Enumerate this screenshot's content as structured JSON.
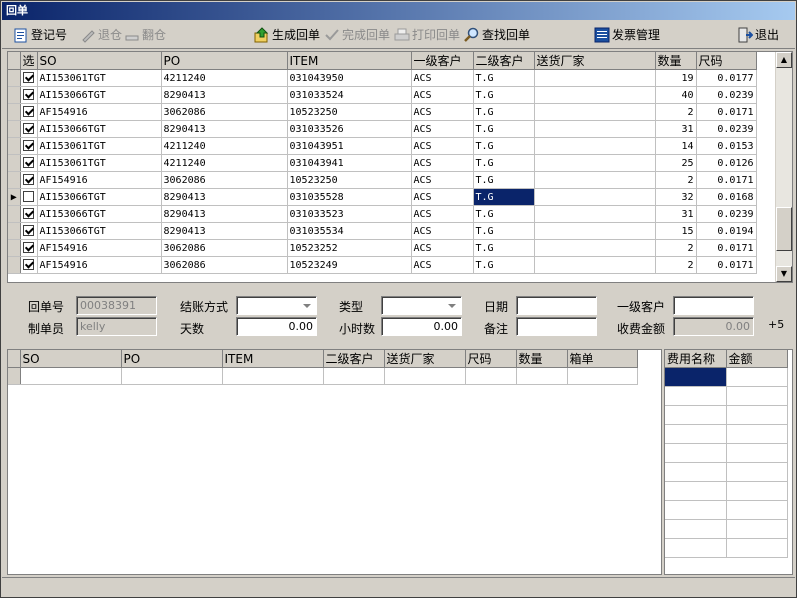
{
  "title": "回单",
  "toolbar": {
    "register": "登记号",
    "return_warehouse": "退仓",
    "flip_warehouse": "翻仓",
    "generate_receipt": "生成回单",
    "complete_receipt": "完成回单",
    "print_receipt": "打印回单",
    "find_receipt": "查找回单",
    "invoice_mgmt": "发票管理",
    "exit": "退出"
  },
  "grid": {
    "headers": [
      "选",
      "SO",
      "PO",
      "ITEM",
      "一级客户",
      "二级客户",
      "送货厂家",
      "数量",
      "尺码"
    ],
    "rows": [
      {
        "checked": true,
        "so": "AI153061TGT",
        "po": "4211240",
        "item": "031043950",
        "c1": "ACS",
        "c2": "T.G",
        "vendor": "",
        "qty": "19",
        "size": "0.0177"
      },
      {
        "checked": true,
        "so": "AI153066TGT",
        "po": "8290413",
        "item": "031033524",
        "c1": "ACS",
        "c2": "T.G",
        "vendor": "",
        "qty": "40",
        "size": "0.0239"
      },
      {
        "checked": true,
        "so": "AF154916",
        "po": "3062086",
        "item": "10523250",
        "c1": "ACS",
        "c2": "T.G",
        "vendor": "",
        "qty": "2",
        "size": "0.0171"
      },
      {
        "checked": true,
        "so": "AI153066TGT",
        "po": "8290413",
        "item": "031033526",
        "c1": "ACS",
        "c2": "T.G",
        "vendor": "",
        "qty": "31",
        "size": "0.0239"
      },
      {
        "checked": true,
        "so": "AI153061TGT",
        "po": "4211240",
        "item": "031043951",
        "c1": "ACS",
        "c2": "T.G",
        "vendor": "",
        "qty": "14",
        "size": "0.0153"
      },
      {
        "checked": true,
        "so": "AI153061TGT",
        "po": "4211240",
        "item": "031043941",
        "c1": "ACS",
        "c2": "T.G",
        "vendor": "",
        "qty": "25",
        "size": "0.0126"
      },
      {
        "checked": true,
        "so": "AF154916",
        "po": "3062086",
        "item": "10523250",
        "c1": "ACS",
        "c2": "T.G",
        "vendor": "",
        "qty": "2",
        "size": "0.0171"
      },
      {
        "checked": false,
        "so": "AI153066TGT",
        "po": "8290413",
        "item": "031035528",
        "c1": "ACS",
        "c2": "T.G",
        "vendor": "",
        "qty": "32",
        "size": "0.0168",
        "current": true
      },
      {
        "checked": true,
        "so": "AI153066TGT",
        "po": "8290413",
        "item": "031033523",
        "c1": "ACS",
        "c2": "T.G",
        "vendor": "",
        "qty": "31",
        "size": "0.0239"
      },
      {
        "checked": true,
        "so": "AI153066TGT",
        "po": "8290413",
        "item": "031035534",
        "c1": "ACS",
        "c2": "T.G",
        "vendor": "",
        "qty": "15",
        "size": "0.0194"
      },
      {
        "checked": true,
        "so": "AF154916",
        "po": "3062086",
        "item": "10523252",
        "c1": "ACS",
        "c2": "T.G",
        "vendor": "",
        "qty": "2",
        "size": "0.0171"
      },
      {
        "checked": true,
        "so": "AF154916",
        "po": "3062086",
        "item": "10523249",
        "c1": "ACS",
        "c2": "T.G",
        "vendor": "",
        "qty": "2",
        "size": "0.0171"
      }
    ]
  },
  "form": {
    "receipt_no_label": "回单号",
    "receipt_no": "00038391",
    "settle_label": "结账方式",
    "settle": "",
    "type_label": "类型",
    "type": "",
    "date_label": "日期",
    "date": "",
    "customer1_label": "一级客户",
    "customer1": "",
    "maker_label": "制单员",
    "maker": "kelly",
    "days_label": "天数",
    "days": "0.00",
    "hours_label": "小时数",
    "hours": "0.00",
    "remark_label": "备注",
    "remark": "",
    "fee_label": "收费金额",
    "fee": "0.00",
    "plus5": "+5"
  },
  "grid2": {
    "headers": [
      "SO",
      "PO",
      "ITEM",
      "二级客户",
      "送货厂家",
      "尺码",
      "数量",
      "箱单"
    ]
  },
  "grid3": {
    "headers": [
      "费用名称",
      "金额"
    ]
  },
  "colors": {
    "title_start": "#0a246a",
    "title_end": "#a6caf0",
    "selection": "#0a246a",
    "face": "#d4d0c8"
  }
}
